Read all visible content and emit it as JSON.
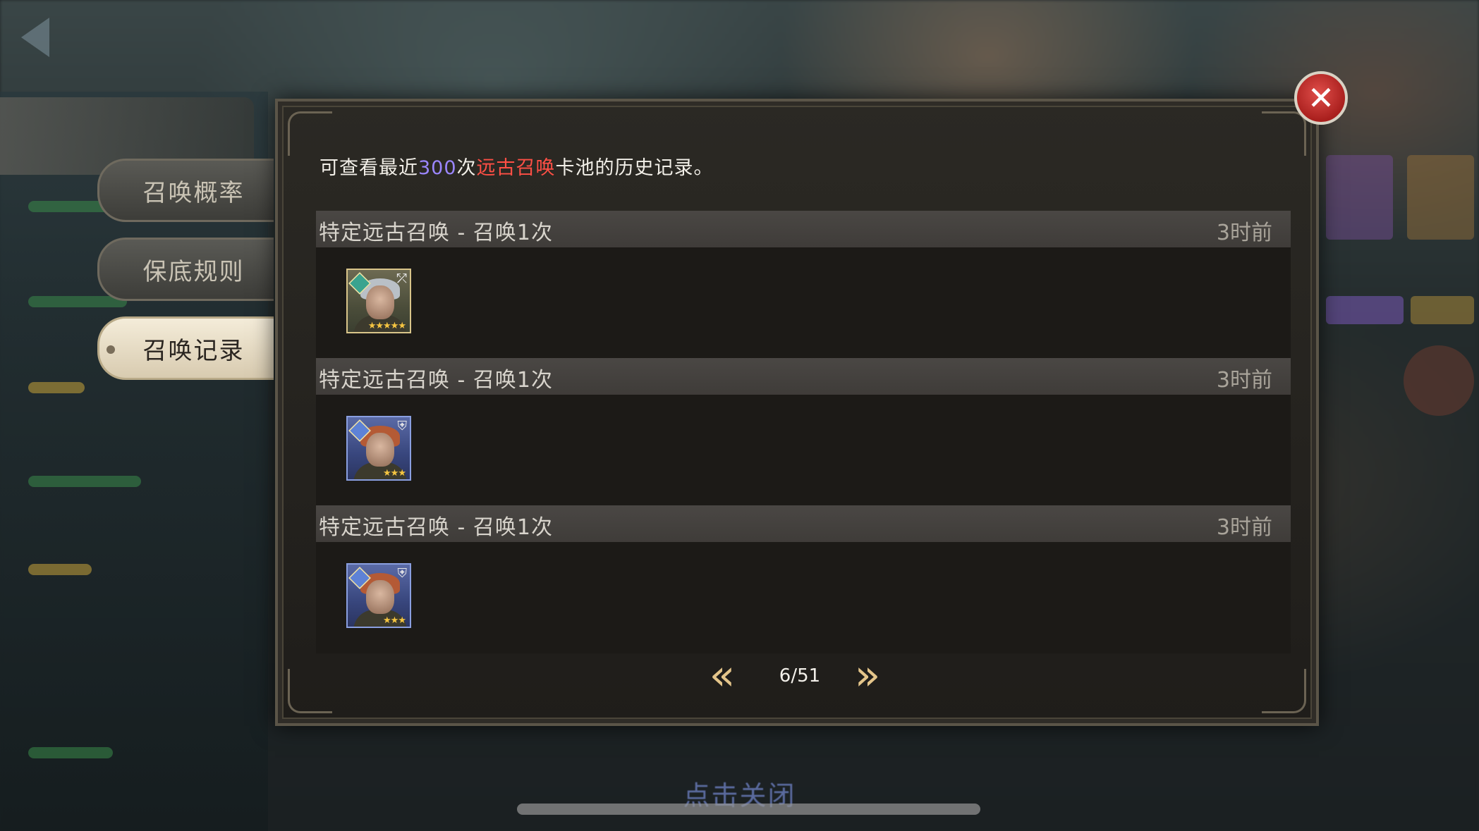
{
  "window": {
    "footer_hint": "点击关闭"
  },
  "side_tabs": [
    {
      "label": "召唤概率",
      "active": false
    },
    {
      "label": "保底规则",
      "active": false
    },
    {
      "label": "召唤记录",
      "active": true
    }
  ],
  "dialog": {
    "description": {
      "prefix": "可查看最近",
      "count": "300",
      "middle": "次",
      "pool_name": "远古召唤",
      "suffix": "卡池的历史记录。"
    },
    "entries": [
      {
        "title": "特定远古召唤 - 召唤1次",
        "time": "3时前",
        "hero": {
          "rarity": "gold",
          "stars": "★★★★★",
          "class_icon": "archer-icon"
        }
      },
      {
        "title": "特定远古召唤 - 召唤1次",
        "time": "3时前",
        "hero": {
          "rarity": "blue",
          "stars": "★★★",
          "class_icon": "shield-icon"
        }
      },
      {
        "title": "特定远古召唤 - 召唤1次",
        "time": "3时前",
        "hero": {
          "rarity": "blue",
          "stars": "★★★",
          "class_icon": "shield-icon"
        }
      }
    ],
    "pagination": {
      "current_page": 6,
      "total_pages": 51,
      "label": "6/51",
      "prev_icon": "double-chevron-left-icon",
      "next_icon": "double-chevron-right-icon"
    },
    "close_icon": "close-icon"
  },
  "colors": {
    "highlight_count": "#9b86ff",
    "highlight_pool": "#ff4f45",
    "arrow": "#e4c58a",
    "close_button": "#c8302c"
  }
}
